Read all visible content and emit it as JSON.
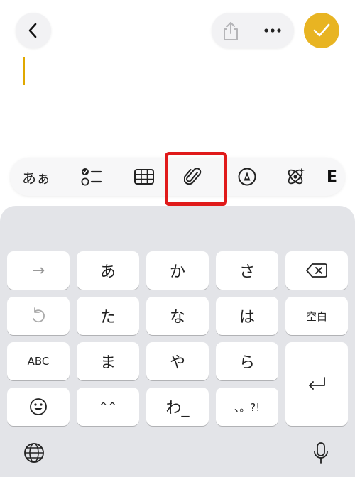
{
  "header": {
    "back_icon": "chevron-left-icon",
    "share_icon": "share-icon",
    "more_icon": "ellipsis-icon",
    "done_icon": "checkmark-icon",
    "accent": "#e8b422"
  },
  "format_bar": {
    "text_style_label": "あぁ",
    "checklist_icon": "checklist-icon",
    "table_icon": "table-icon",
    "attachment_icon": "paperclip-icon",
    "markup_icon": "pen-icon",
    "ai_icon": "sparkle-icon",
    "partial_label": "E",
    "highlight_color": "#e01a1a"
  },
  "keyboard": {
    "row1": [
      "→",
      "あ",
      "か",
      "さ"
    ],
    "row2": [
      "た",
      "な",
      "は",
      "空白"
    ],
    "row3": [
      "ABC",
      "ま",
      "や",
      "ら"
    ],
    "row4": [
      "^^",
      "わ_",
      "、。?!"
    ],
    "undo_icon": "undo-icon",
    "delete_icon": "delete-icon",
    "return_icon": "return-icon",
    "emoji_icon": "emoji-icon",
    "globe_icon": "globe-icon",
    "mic_icon": "microphone-icon"
  }
}
